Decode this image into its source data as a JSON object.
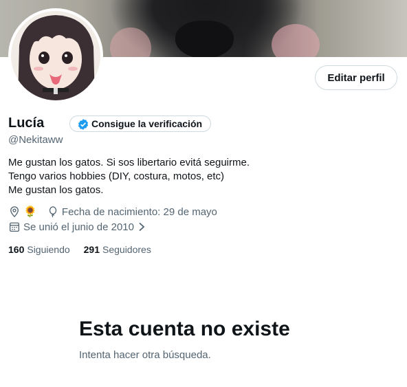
{
  "profile": {
    "name": "Lucía",
    "handle": "@Nekitaww",
    "verify_label": "Consigue la verificación",
    "edit_label": "Editar perfil",
    "bio": [
      "Me gustan los gatos. Si sos libertario evitá seguirme.",
      "Tengo varios hobbies (DIY, costura, motos, etc)",
      "Me gustan los gatos."
    ],
    "location_emoji": "🌻",
    "birthday": "Fecha de nacimiento: 29 de mayo",
    "joined": "Se unió el junio de 2010",
    "following_count": "160",
    "following_label": "Siguiendo",
    "followers_count": "291",
    "followers_label": "Seguidores"
  },
  "empty_state": {
    "title": "Esta cuenta no existe",
    "subtitle": "Intenta hacer otra búsqueda."
  },
  "icons": {
    "location": "location-pin-icon",
    "birthday": "balloon-icon",
    "joined": "calendar-icon",
    "verify": "verified-badge-icon",
    "chevron": "chevron-right-icon"
  },
  "colors": {
    "text": "#0f1419",
    "secondary": "#536471",
    "verified_blue": "#1d9bf0",
    "border": "#cfd9de"
  }
}
